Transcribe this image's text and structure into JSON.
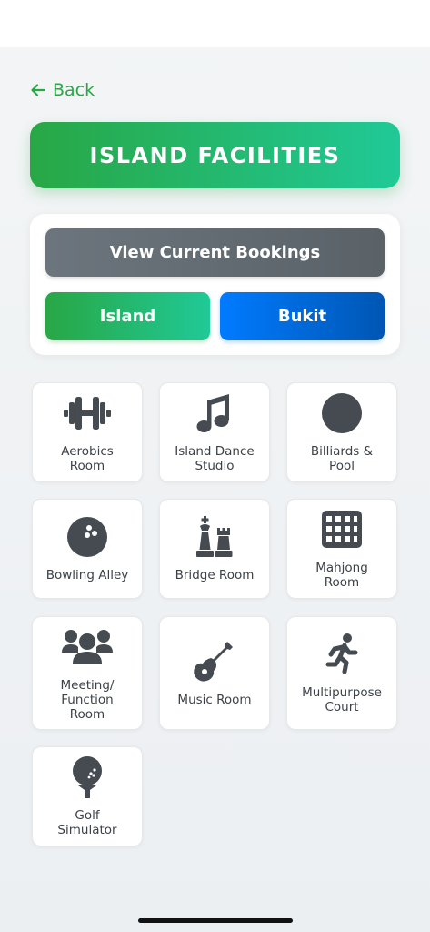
{
  "header": {
    "back_label": "Back",
    "title": "ISLAND FACILITIES"
  },
  "controls": {
    "bookings_label": "View Current Bookings",
    "island_label": "Island",
    "bukit_label": "Bukit"
  },
  "facilities": [
    {
      "label": "Aerobics\nRoom",
      "icon": "dumbbell-icon"
    },
    {
      "label": "Island Dance\nStudio",
      "icon": "music-note-icon"
    },
    {
      "label": "Billiards &\nPool",
      "icon": "billiard-ball-icon"
    },
    {
      "label": "Bowling Alley",
      "icon": "bowling-ball-icon"
    },
    {
      "label": "Bridge Room",
      "icon": "chess-pieces-icon"
    },
    {
      "label": "Mahjong\nRoom",
      "icon": "grid-icon"
    },
    {
      "label": "Meeting/\nFunction\nRoom",
      "icon": "people-group-icon"
    },
    {
      "label": "Music Room",
      "icon": "guitar-icon"
    },
    {
      "label": "Multipurpose\nCourt",
      "icon": "running-person-icon"
    },
    {
      "label": "Golf\nSimulator",
      "icon": "golf-ball-tee-icon"
    }
  ],
  "colors": {
    "green": "#28a745",
    "teal": "#20c997",
    "blue": "#007bff",
    "gray": "#6c757d",
    "icon": "#454b51"
  }
}
